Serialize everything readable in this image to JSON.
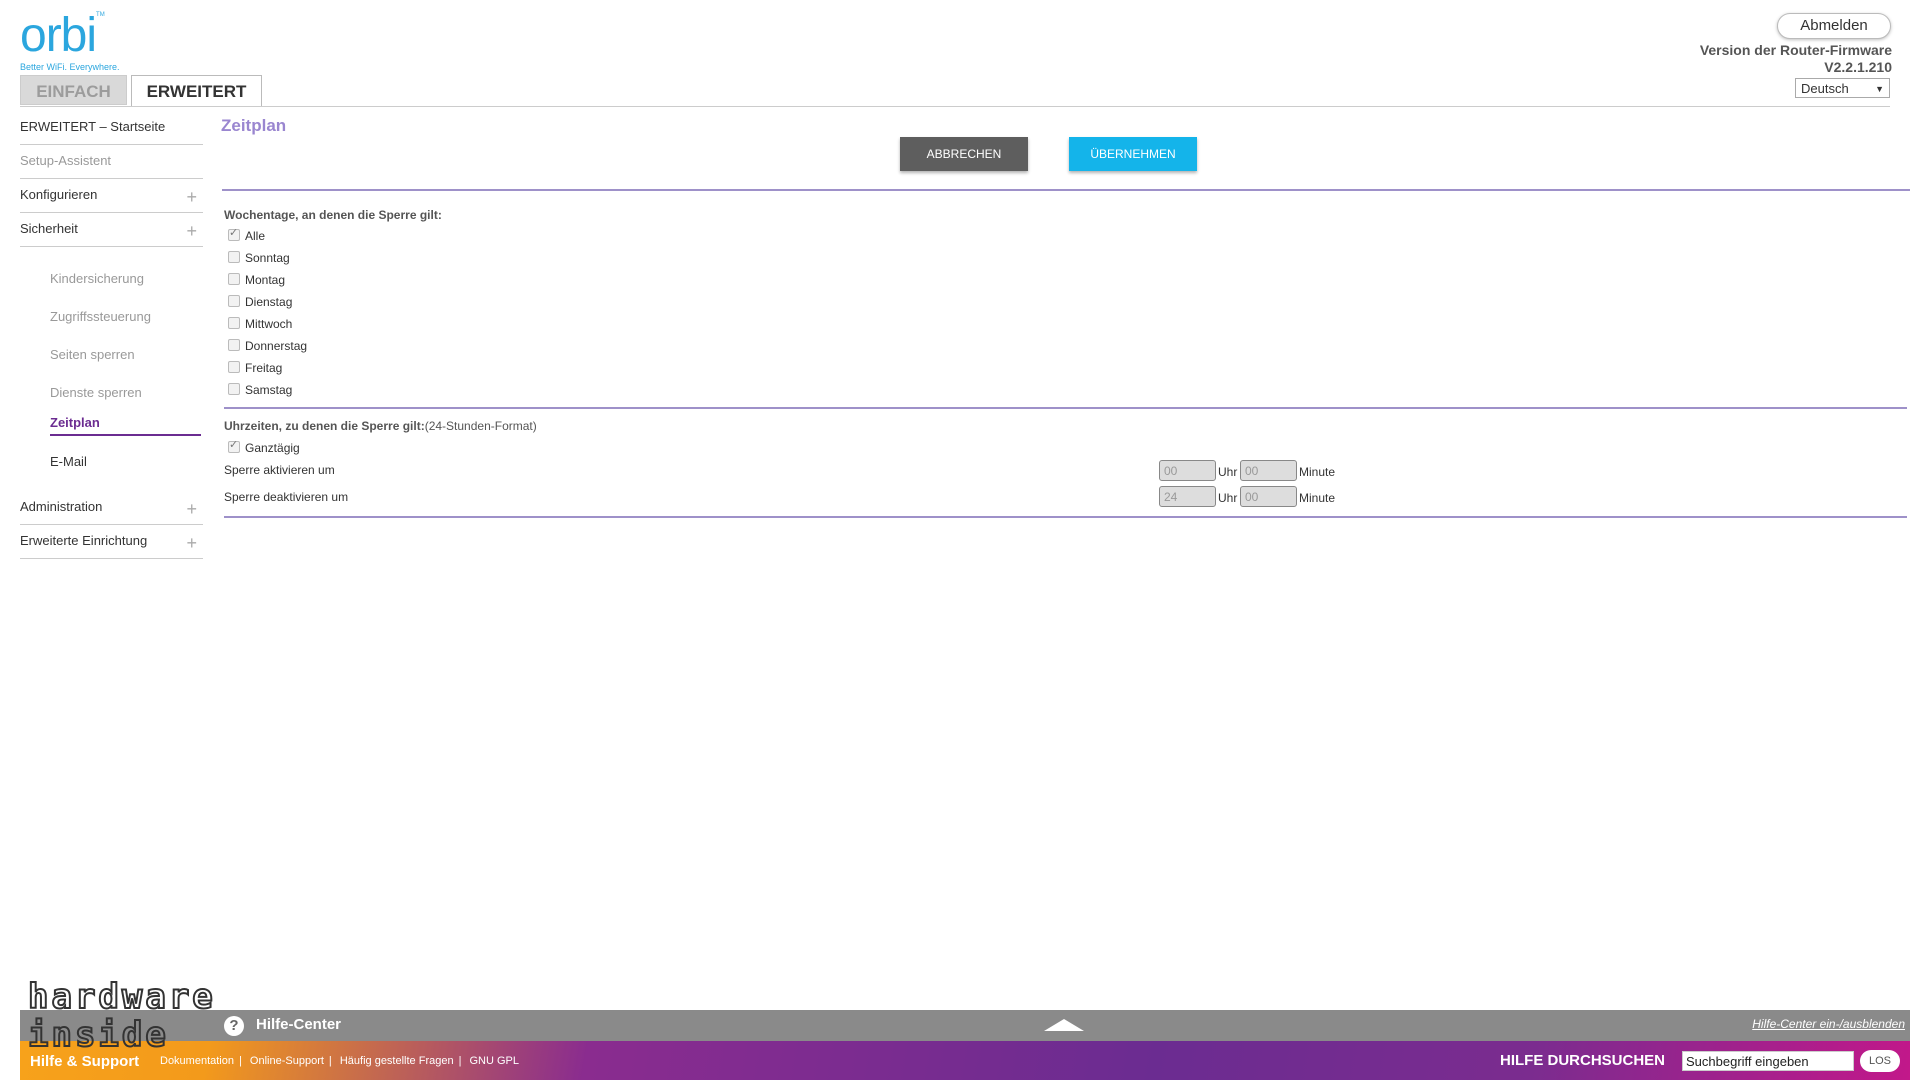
{
  "header": {
    "logo_text": "orbi",
    "logo_tm": "TM",
    "logo_tagline": "Better WiFi. Everywhere.",
    "logout_label": "Abmelden",
    "firmware_label": "Version der Router-Firmware",
    "firmware_version": "V2.2.1.210",
    "language": "Deutsch"
  },
  "tabs": {
    "simple": "EINFACH",
    "advanced": "ERWEITERT"
  },
  "sidebar": {
    "home": "ERWEITERT – Startseite",
    "setup": "Setup-Assistent",
    "configure": "Konfigurieren",
    "security": "Sicherheit",
    "sub": {
      "parental": "Kindersicherung",
      "access": "Zugriffssteuerung",
      "block_sites": "Seiten sperren",
      "block_services": "Dienste sperren",
      "schedule": "Zeitplan",
      "email": "E-Mail"
    },
    "administration": "Administration",
    "advanced_setup": "Erweiterte Einrichtung"
  },
  "main": {
    "title": "Zeitplan",
    "cancel_label": "ABBRECHEN",
    "apply_label": "ÜBERNEHMEN",
    "days_heading": "Wochentage, an denen die Sperre gilt:",
    "days": [
      {
        "label": "Alle",
        "checked": true
      },
      {
        "label": "Sonntag",
        "checked": false
      },
      {
        "label": "Montag",
        "checked": false
      },
      {
        "label": "Dienstag",
        "checked": false
      },
      {
        "label": "Mittwoch",
        "checked": false
      },
      {
        "label": "Donnerstag",
        "checked": false
      },
      {
        "label": "Freitag",
        "checked": false
      },
      {
        "label": "Samstag",
        "checked": false
      }
    ],
    "times_heading": "Uhrzeiten, zu denen die Sperre gilt:",
    "times_format": "(24-Stunden-Format)",
    "all_day_label": "Ganztägig",
    "all_day_checked": true,
    "start_label": "Sperre aktivieren um",
    "end_label": "Sperre deaktivieren um",
    "start_hour": "00",
    "start_minute": "00",
    "end_hour": "24",
    "end_minute": "00",
    "hour_unit": "Uhr",
    "minute_unit": "Minute"
  },
  "footer": {
    "help_center": "Hilfe-Center",
    "help_toggle": "Hilfe-Center ein-/ausblenden",
    "support_title": "Hilfe & Support",
    "links": [
      "Dokumentation",
      "Online-Support",
      "Häufig gestellte Fragen",
      "GNU GPL"
    ],
    "search_label": "HILFE DURCHSUCHEN",
    "search_placeholder": "Suchbegriff eingeben",
    "search_button": "LOS"
  },
  "watermark": {
    "line1": "hardware",
    "line2": "inside"
  },
  "colors": {
    "accent_blue": "#14b4ea",
    "title_purple": "#9a86d0",
    "active_purple": "#6b2c91",
    "cancel_grey": "#5e5e5e"
  }
}
